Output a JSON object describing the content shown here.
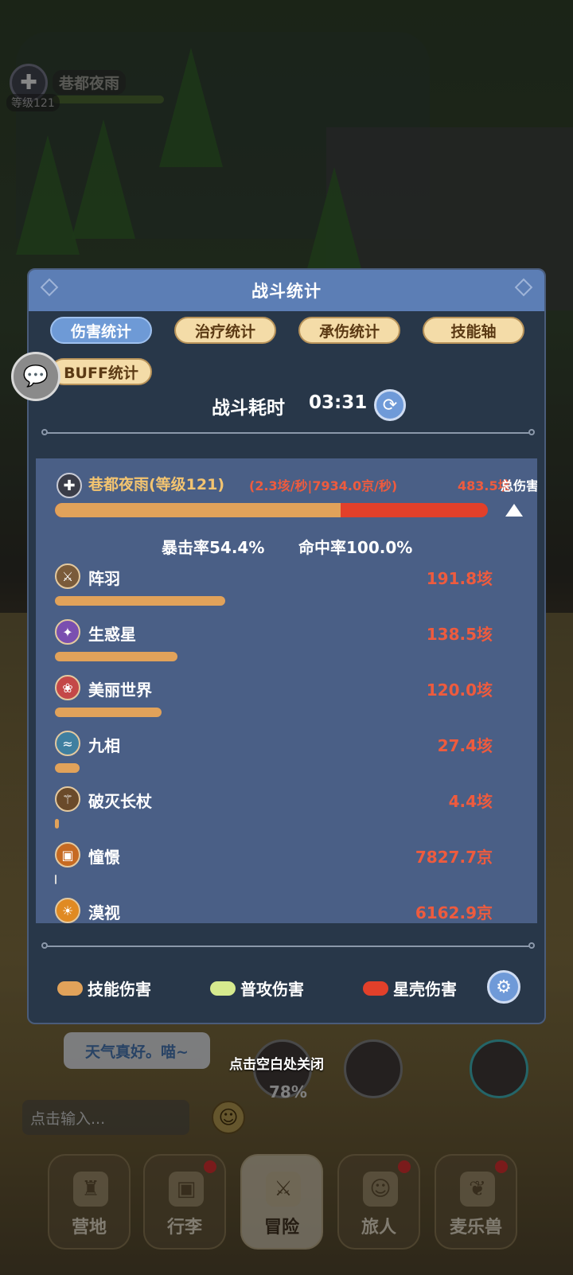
{
  "player": {
    "name": "巷都夜雨",
    "level": "等级121",
    "emblem_icon": "cross-icon"
  },
  "panel": {
    "title": "战斗统计",
    "tabs": [
      {
        "label": "伤害统计",
        "active": true
      },
      {
        "label": "治疗统计",
        "active": false
      },
      {
        "label": "承伤统计",
        "active": false
      },
      {
        "label": "技能轴",
        "active": false
      },
      {
        "label": "BUFF统计",
        "active": false
      }
    ],
    "timer_label": "战斗耗时",
    "timer_value": "03:31",
    "summary": {
      "name": "巷都夜雨(等级121)",
      "rate": "(2.3垓/秒|7934.0京/秒)",
      "total": "483.5垓",
      "total_label": "总伤害",
      "skill_fraction": 0.66,
      "crit": "暴击率54.4%",
      "hit": "命中率100.0%"
    },
    "skills": [
      {
        "name": "阵羽",
        "value": "191.8垓",
        "share": 0.397,
        "color": "#7a5b3a",
        "icon": "sword-icon"
      },
      {
        "name": "生惑星",
        "value": "138.5垓",
        "share": 0.286,
        "color": "#7a4fb0",
        "icon": "star-icon"
      },
      {
        "name": "美丽世界",
        "value": "120.0垓",
        "share": 0.248,
        "color": "#c44848",
        "icon": "flower-icon"
      },
      {
        "name": "九相",
        "value": "27.4垓",
        "share": 0.057,
        "color": "#3f7fa0",
        "icon": "wave-icon"
      },
      {
        "name": "破灭长杖",
        "value": "4.4垓",
        "share": 0.009,
        "color": "#6a4a2a",
        "icon": "staff-icon"
      },
      {
        "name": "憧憬",
        "value": "7827.7京",
        "share": 0.0016,
        "color": "#c66a22",
        "icon": "chest-icon"
      },
      {
        "name": "漠视",
        "value": "6162.9京",
        "share": 0.0013,
        "color": "#e08a22",
        "icon": "sun-icon"
      }
    ],
    "legend": [
      {
        "label": "技能伤害",
        "color": "#e1a25a"
      },
      {
        "label": "普攻伤害",
        "color": "#d6ea8e"
      },
      {
        "label": "星壳伤害",
        "color": "#e2402a"
      }
    ],
    "close_hint": "点击空白处关闭"
  },
  "hud": {
    "weather_msg": "天气真好。喵~",
    "chat_placeholder": "点击输入...",
    "skill_percent": "78%",
    "nav": [
      {
        "label": "营地",
        "active": false,
        "badge": false,
        "icon": "castle-icon"
      },
      {
        "label": "行李",
        "active": false,
        "badge": true,
        "icon": "chest-icon"
      },
      {
        "label": "冒险",
        "active": true,
        "badge": false,
        "icon": "crossed-swords-icon"
      },
      {
        "label": "旅人",
        "active": false,
        "badge": true,
        "icon": "character-icon"
      },
      {
        "label": "麦乐兽",
        "active": false,
        "badge": true,
        "icon": "pet-icon"
      }
    ]
  }
}
